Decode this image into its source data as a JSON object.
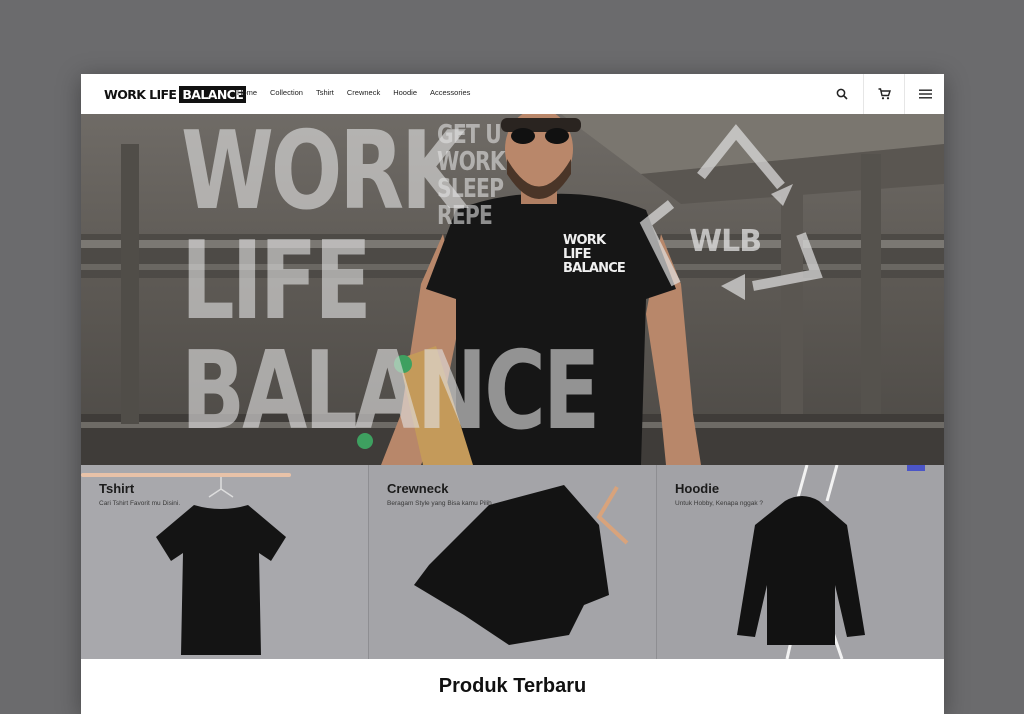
{
  "brand": {
    "logo_plain": "WORK LIFE",
    "logo_boxed": "BALANCE"
  },
  "nav": {
    "items": [
      "Home",
      "Collection",
      "Tshirt",
      "Crewneck",
      "Hoodie",
      "Accessories"
    ],
    "icons": [
      "search-icon",
      "cart-icon",
      "hamburger-menu-icon"
    ]
  },
  "hero": {
    "big_lines": [
      "WORK",
      "LIFE",
      "BALANCE"
    ],
    "small_lines": [
      "GET U",
      "WORK",
      "SLEEP",
      "REPE"
    ],
    "badge": "WLB",
    "shirt_print": [
      "WORK",
      "LIFE",
      "BALANCE"
    ]
  },
  "categories": [
    {
      "title": "Tshirt",
      "desc": "Cari Tshirt Favorit mu Disini."
    },
    {
      "title": "Crewneck",
      "desc": "Beragam Style yang Bisa kamu Pilih."
    },
    {
      "title": "Hoodie",
      "desc": "Untuk Hobby, Kenapa nggak ?"
    }
  ],
  "section": {
    "title": "Produk Terbaru"
  },
  "colors": {
    "accent": "#111111",
    "background": "#6b6b6d",
    "card": "#a6a6aa"
  }
}
